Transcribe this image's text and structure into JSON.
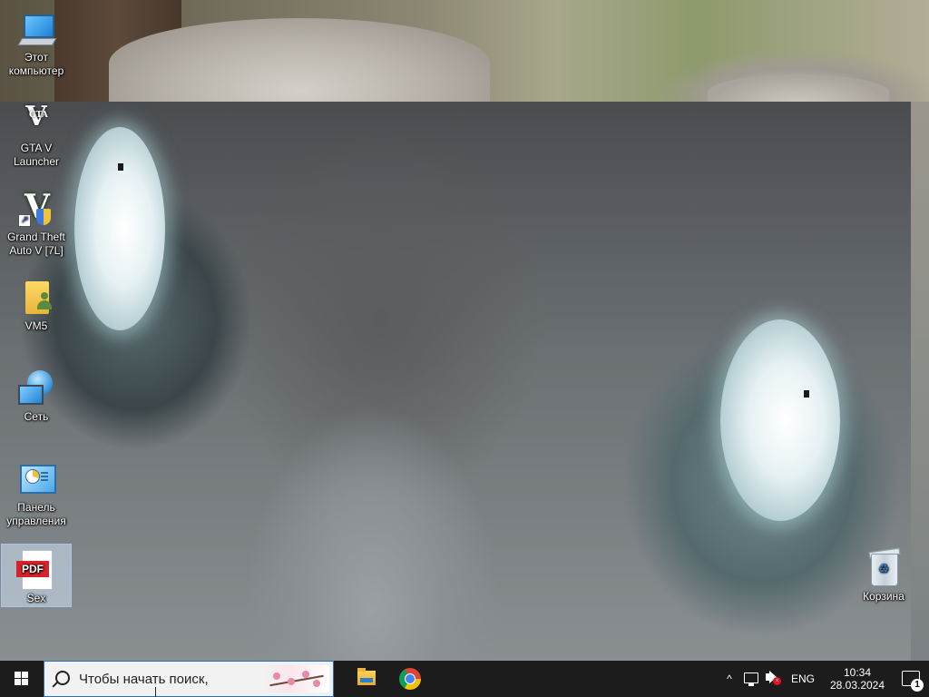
{
  "desktop": {
    "icons": [
      {
        "id": "this-pc",
        "label": "Этот компьютер",
        "icon": "computer-icon"
      },
      {
        "id": "gta-v-launcher",
        "label": "GTA V Launcher",
        "icon": "gta-v-launcher-icon"
      },
      {
        "id": "gta-v-7l",
        "label": "Grand Theft Auto V [7L]",
        "icon": "gta-v-shortcut-icon"
      },
      {
        "id": "vm5",
        "label": "VM5",
        "icon": "user-folder-icon"
      },
      {
        "id": "network",
        "label": "Сеть",
        "icon": "network-icon"
      },
      {
        "id": "control-panel",
        "label": "Панель управления",
        "icon": "control-panel-icon"
      },
      {
        "id": "sex-pdf",
        "label": "Sex",
        "icon": "pdf-file-icon",
        "selected": true
      },
      {
        "id": "recycle-bin",
        "label": "Корзина",
        "icon": "recycle-bin-icon"
      }
    ],
    "gta_badge_text": "V",
    "gta_small_text": "GTA",
    "pdf_tag": "PDF",
    "recycle_symbol": "♻"
  },
  "taskbar": {
    "search_placeholder": "Чтобы начать поиск,",
    "pinned": [
      {
        "id": "file-explorer",
        "icon": "folder-icon"
      },
      {
        "id": "chrome",
        "icon": "chrome-icon"
      }
    ],
    "tray": {
      "chevron": "^",
      "language": "ENG",
      "time": "10:34",
      "date": "28.03.2024",
      "notification_count": "1",
      "volume_muted_mark": "×"
    }
  },
  "colors": {
    "taskbar_bg": "#1c1c1c",
    "search_bg": "#f2f2f2",
    "selection": "#cde1f5"
  }
}
